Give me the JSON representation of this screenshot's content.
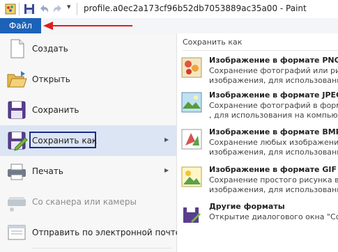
{
  "window": {
    "title": "profile.a0ec2a173cf96b52db7053889ac35a00 - Paint"
  },
  "quick_access": {
    "customize_glyph": "▾"
  },
  "ribbon": {
    "file_tab": "Файл"
  },
  "menu": {
    "items": [
      {
        "label": "Создать",
        "icon": "new-document-icon"
      },
      {
        "label": "Открыть",
        "icon": "open-folder-icon"
      },
      {
        "label": "Сохранить",
        "icon": "save-disk-icon"
      },
      {
        "label": "Сохранить как",
        "icon": "save-as-icon",
        "has_submenu": true,
        "highlighted": true
      },
      {
        "label": "Печать",
        "icon": "printer-icon",
        "has_submenu": true
      },
      {
        "label": "Со сканера или камеры",
        "icon": "scanner-icon",
        "disabled": true
      },
      {
        "label": "Отправить по электронной почте",
        "icon": "email-icon"
      }
    ],
    "submenu_chevron": "▶"
  },
  "save_as_pane": {
    "title": "Сохранить как",
    "options": [
      {
        "title": "Изображение в формате PNG",
        "desc_1": "Сохранение фотографий или рису",
        "desc_2": "изображения, для использования",
        "icon": "png-image-icon"
      },
      {
        "title": "Изображение в формате JPEG",
        "desc_1": "Сохранение фотографий в форма",
        ", desc_2": "",
        "desc_2_text": ", для использования на компьютер",
        "icon": "jpeg-image-icon"
      },
      {
        "title": "Изображение в формате BMP",
        "desc_1": "Сохранение любых изображений",
        "desc_2": "изображения, для использования",
        "icon": "bmp-image-icon"
      },
      {
        "title": "Изображение в формате GIF",
        "desc_1": "Сохранение простого рисунка в ф",
        "desc_2": "изображения, для использования",
        "icon": "gif-image-icon"
      },
      {
        "title": "Другие форматы",
        "desc_1": "Открытие диалогового окна \"Сох",
        "desc_2": "",
        "icon": "other-formats-icon"
      }
    ]
  },
  "colors": {
    "file_tab": "#1b62b8",
    "highlight": "#dbe5f3",
    "saveas_outline": "#1e2a8a",
    "annotation_arrow": "#e21c1c"
  }
}
